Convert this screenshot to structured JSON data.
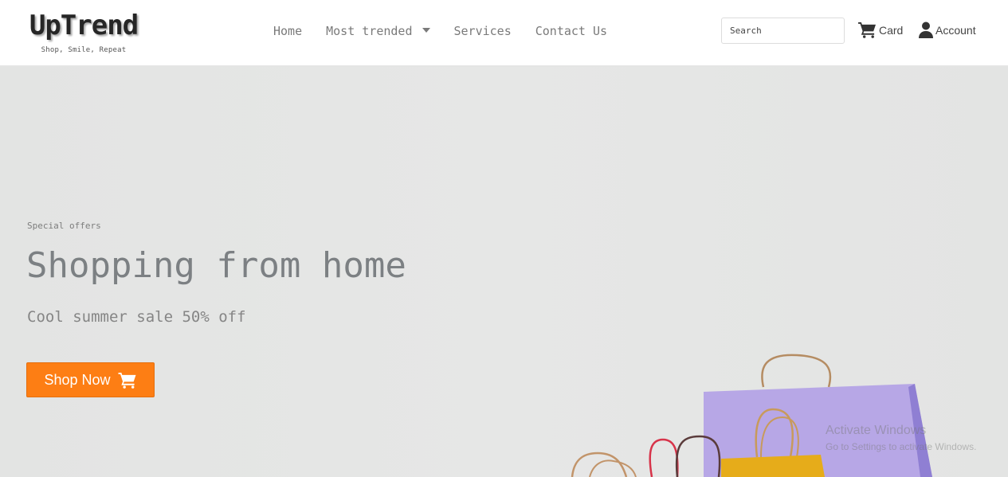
{
  "brand": {
    "name": "UpTrend",
    "tagline": "Shop, Smile, Repeat"
  },
  "nav": {
    "home": "Home",
    "most_trended": "Most trended",
    "services": "Services",
    "contact": "Contact Us"
  },
  "search": {
    "placeholder": "Search"
  },
  "actions": {
    "card": "Card",
    "account": "Account"
  },
  "hero": {
    "label": "Special offers",
    "title": "Shopping from home",
    "subtitle": "Cool summer sale 50% off",
    "button": "Shop Now"
  },
  "watermark": {
    "line1": "Activate Windows",
    "line2": "Go to Settings to activate Windows."
  },
  "colors": {
    "accent": "#fd7e14",
    "bag_purple": "#b7a7e6",
    "bag_yellow": "#e6ac1a"
  },
  "icons": [
    "cart-icon",
    "user-icon",
    "caret-down-icon"
  ]
}
